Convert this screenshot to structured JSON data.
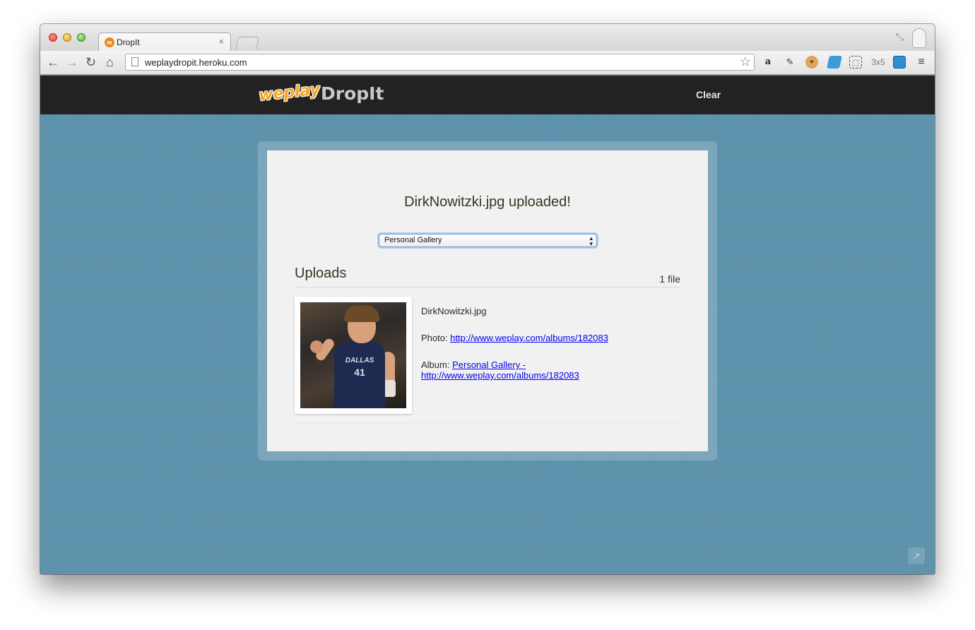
{
  "browser": {
    "tab_title": "DropIt",
    "tab_favicon_letter": "w",
    "url": "weplaydropit.heroku.com",
    "extension_grid_label": "3x5"
  },
  "header": {
    "logo_weplay": "weplay",
    "logo_dropit": "DropIt",
    "clear_label": "Clear"
  },
  "main": {
    "upload_message": "DirkNowitzki.jpg uploaded!",
    "gallery_select": {
      "selected": "Personal Gallery"
    },
    "uploads_heading": "Uploads",
    "file_count": "1 file",
    "uploads": [
      {
        "file_name": "DirkNowitzki.jpg",
        "photo_label": "Photo:",
        "photo_link": "http://www.weplay.com/albums/182083",
        "album_label": "Album:",
        "album_link_line1": "Personal Gallery -",
        "album_link_line2": "http://www.weplay.com/albums/182083",
        "thumb_jersey_text": "DALLAS",
        "thumb_jersey_number": "41"
      }
    ]
  },
  "colors": {
    "page_background": "#5e93ad",
    "header_background": "#222222",
    "card_background": "#f1f1f1",
    "logo_accent": "#f5a623",
    "link": "#0000ee"
  }
}
